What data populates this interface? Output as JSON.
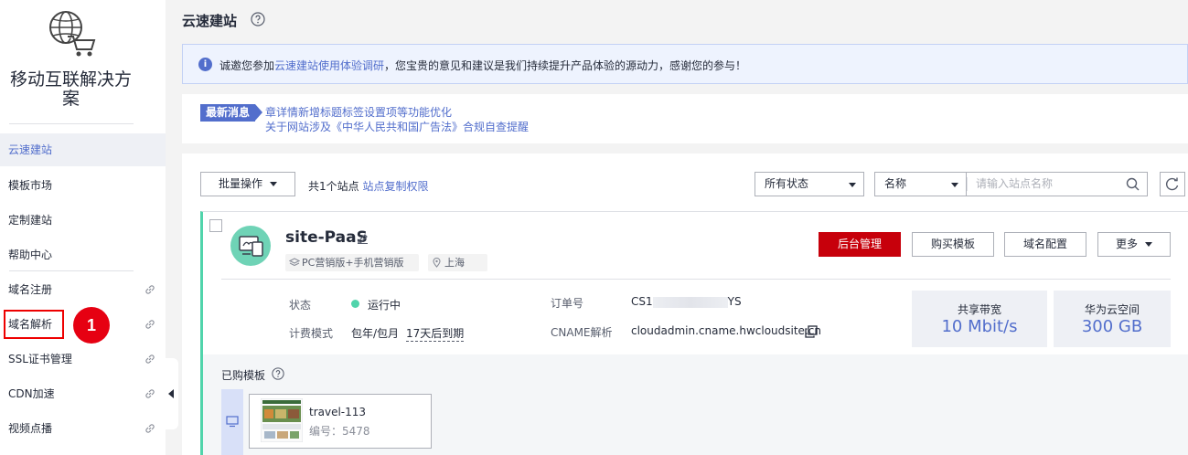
{
  "sidebar": {
    "title": "移动互联解决方案",
    "items": [
      {
        "label": "云速建站",
        "active": true
      },
      {
        "label": "模板市场"
      },
      {
        "label": "定制建站"
      },
      {
        "label": "帮助中心"
      },
      {
        "label": "域名注册"
      },
      {
        "label": "域名解析"
      },
      {
        "label": "SSL证书管理"
      },
      {
        "label": "CDN加速"
      },
      {
        "label": "视频点播"
      }
    ],
    "step_badge": "1"
  },
  "header": {
    "title": "云速建站"
  },
  "notice": {
    "prefix": "诚邀您参加",
    "link": "云速建站使用体验调研",
    "suffix": "，您宝贵的意见和建议是我们持续提升产品体验的源动力，感谢您的参与！"
  },
  "news": {
    "tag": "最新消息",
    "items": [
      "章详情新增标题标签设置项等功能优化",
      "关于网站涉及《中华人民共和国广告法》合规自查提醒"
    ]
  },
  "toolbar": {
    "batch_label": "批量操作",
    "count_text": "共1个站点",
    "copy_link": "站点复制权限",
    "status_select": "所有状态",
    "field_select": "名称",
    "search_placeholder": "请输入站点名称"
  },
  "site": {
    "name": "site-PaaS",
    "edition": "PC营销版+手机营销版",
    "region": "上海",
    "buttons": {
      "admin": "后台管理",
      "buy_template": "购买模板",
      "domain_config": "域名配置",
      "more": "更多"
    },
    "status_label": "状态",
    "status_value": "运行中",
    "billing_label": "计费模式",
    "billing_value": "包年/包月",
    "expire_value": "17天后到期",
    "order_label": "订单号",
    "order_prefix": "CS1",
    "order_suffix": "YS",
    "cname_label": "CNAME解析",
    "cname_value": "cloudadmin.cname.hwcloudsite.cn",
    "bandwidth_label": "共享带宽",
    "bandwidth_value": "10 Mbit/s",
    "storage_label": "华为云空间",
    "storage_value": "300 GB"
  },
  "templates": {
    "title": "已购模板",
    "item_name": "travel-113",
    "item_code": "编号：5478"
  },
  "colors": {
    "primary": "#c7000b",
    "link": "#526ecc",
    "running": "#50d4ab",
    "badge": "#e60012"
  }
}
